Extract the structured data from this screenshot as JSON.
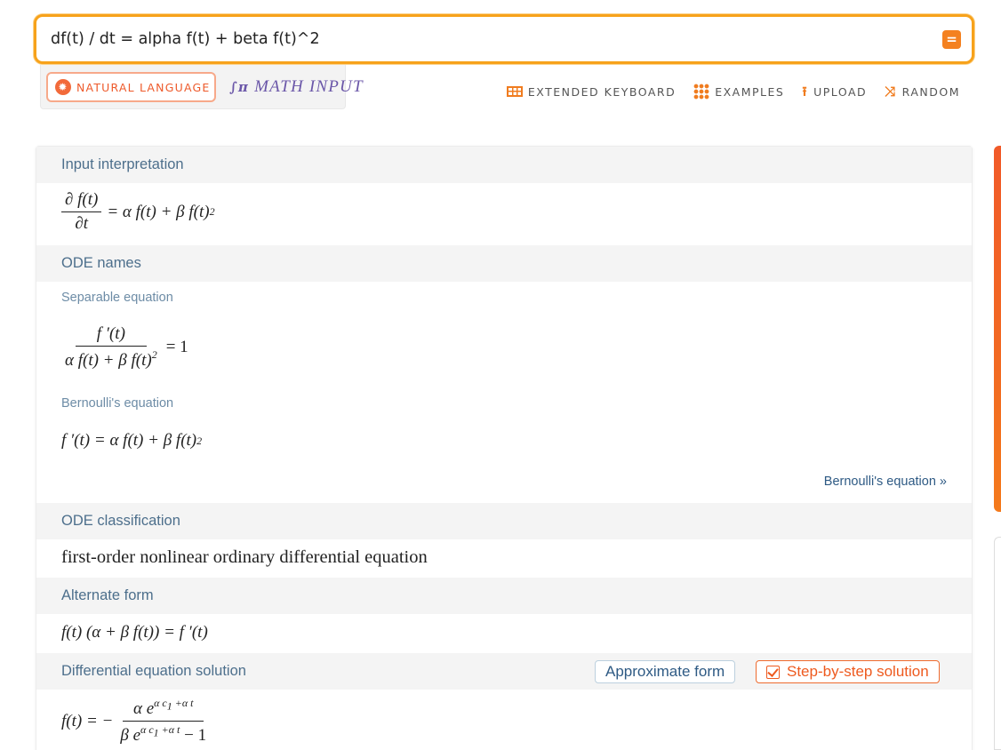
{
  "search": {
    "value": "df(t) / dt = alpha f(t) + beta f(t)^2",
    "compute_icon": "equals-icon",
    "compute_glyph": "="
  },
  "input_modes": {
    "natural_label": "NATURAL LANGUAGE",
    "natural_icon": "gear-icon",
    "math_label": "MATH INPUT",
    "math_icon": "integral-sigma-pi-icon"
  },
  "toolbar": {
    "extended_keyboard": "EXTENDED KEYBOARD",
    "examples": "EXAMPLES",
    "upload": "UPLOAD",
    "random": "RANDOM",
    "accent_color": "#f07c1f"
  },
  "pods": {
    "input_interpretation": {
      "title": "Input interpretation",
      "num": "∂ f(t)",
      "den": "∂t",
      "rhs": "= α f(t) + β f(t)",
      "exp": "2"
    },
    "ode_names": {
      "title": "ODE names",
      "separable_label": "Separable equation",
      "separable_num": "f ′(t)",
      "separable_den": "α f(t) + β f(t)",
      "separable_den_exp": "2",
      "separable_rhs": "= 1",
      "bernoulli_label": "Bernoulli's equation",
      "bernoulli_eq": "f ′(t) = α f(t) + β f(t)",
      "bernoulli_exp": "2",
      "bernoulli_link": "Bernoulli's equation »"
    },
    "ode_classification": {
      "title": "ODE classification",
      "text": "first-order nonlinear ordinary differential equation"
    },
    "alternate_form": {
      "title": "Alternate form",
      "eq": "f(t) (α + β f(t)) = f ′(t)"
    },
    "solution": {
      "title": "Differential equation solution",
      "approx_button": "Approximate form",
      "step_button": "Step-by-step solution",
      "lhs": "f(t) = −",
      "num_base": "α e",
      "num_exp": "α c",
      "num_exp_sub": "1",
      "num_exp_rest": " +α t",
      "den_base": "β e",
      "den_exp": "α c",
      "den_exp_sub": "1",
      "den_exp_rest": " +α t",
      "den_rest": " − 1"
    }
  }
}
